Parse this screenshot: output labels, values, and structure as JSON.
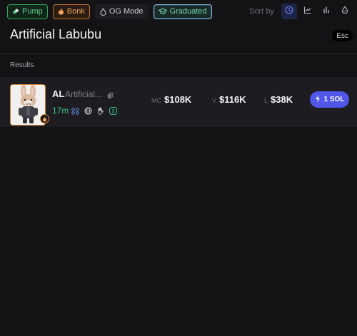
{
  "filters": {
    "pump": {
      "label": "Pump",
      "color": "#2fa85b"
    },
    "bonk": {
      "label": "Bonk",
      "color": "#c8742a"
    },
    "og_mode": {
      "label": "OG Mode"
    },
    "graduated": {
      "label": "Graduated",
      "active": true,
      "color": "#71d3a6"
    }
  },
  "sort": {
    "label": "Sort by",
    "options": [
      {
        "icon": "clock-icon",
        "active": true
      },
      {
        "icon": "line-chart-icon",
        "active": false
      },
      {
        "icon": "bar-chart-icon",
        "active": false
      },
      {
        "icon": "droplet-icon",
        "active": false
      }
    ]
  },
  "search": {
    "query": "Artificial Labubu",
    "esc_label": "Esc"
  },
  "results": {
    "label": "Results",
    "items": [
      {
        "ticker": "AL",
        "name": "Artificial...",
        "age": "17m",
        "icons": [
          "holders-icon",
          "globe-icon",
          "hand-icon",
          "dollar-badge-icon"
        ],
        "mc_label": "MC",
        "mc_value": "$108K",
        "v_label": "V",
        "v_value": "$116K",
        "l_label": "L",
        "l_value": "$38K",
        "buy_label": "1 SOL"
      }
    ]
  },
  "colors": {
    "accent": "#5057e8",
    "positive": "#3cc685",
    "bonk": "#d38433"
  }
}
